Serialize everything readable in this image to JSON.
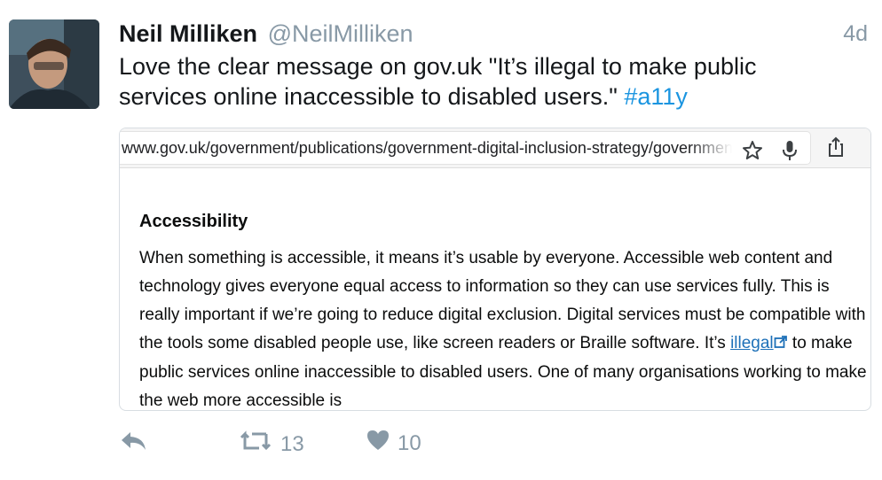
{
  "tweet": {
    "author_name": "Neil Milliken",
    "author_handle": "@NeilMilliken",
    "time": "4d",
    "text": "Love the clear message on gov.uk \"It’s illegal to make public services online inaccessible to disabled users.\" ",
    "hashtag": "#a11y"
  },
  "screenshot": {
    "url": "www.gov.uk/government/publications/government-digital-inclusion-strategy/government-digital-inclusion-strategy",
    "heading": "Accessibility",
    "paragraph_before_link": "When something is accessible, it means it’s usable by everyone. Accessible web content and technology gives everyone equal access to information so they can use services fully. This is really important if we’re going to reduce digital exclusion. Digital services must be compatible with the tools some disabled people use, like screen readers or Braille software. It’s ",
    "link_text": "illegal",
    "paragraph_after_link": " to make public services online inaccessible to disabled users. One of many organisations working to make the web more accessible is",
    "icons": [
      "star-icon",
      "microphone-icon",
      "share-icon",
      "external-link-icon"
    ]
  },
  "actions": {
    "retweet_count": "13",
    "like_count": "10",
    "icons": [
      "reply-icon",
      "retweet-icon",
      "heart-icon"
    ]
  },
  "colors": {
    "hashtag": "#1b95e0",
    "muted": "#8899a6",
    "link": "#1d70b8"
  }
}
